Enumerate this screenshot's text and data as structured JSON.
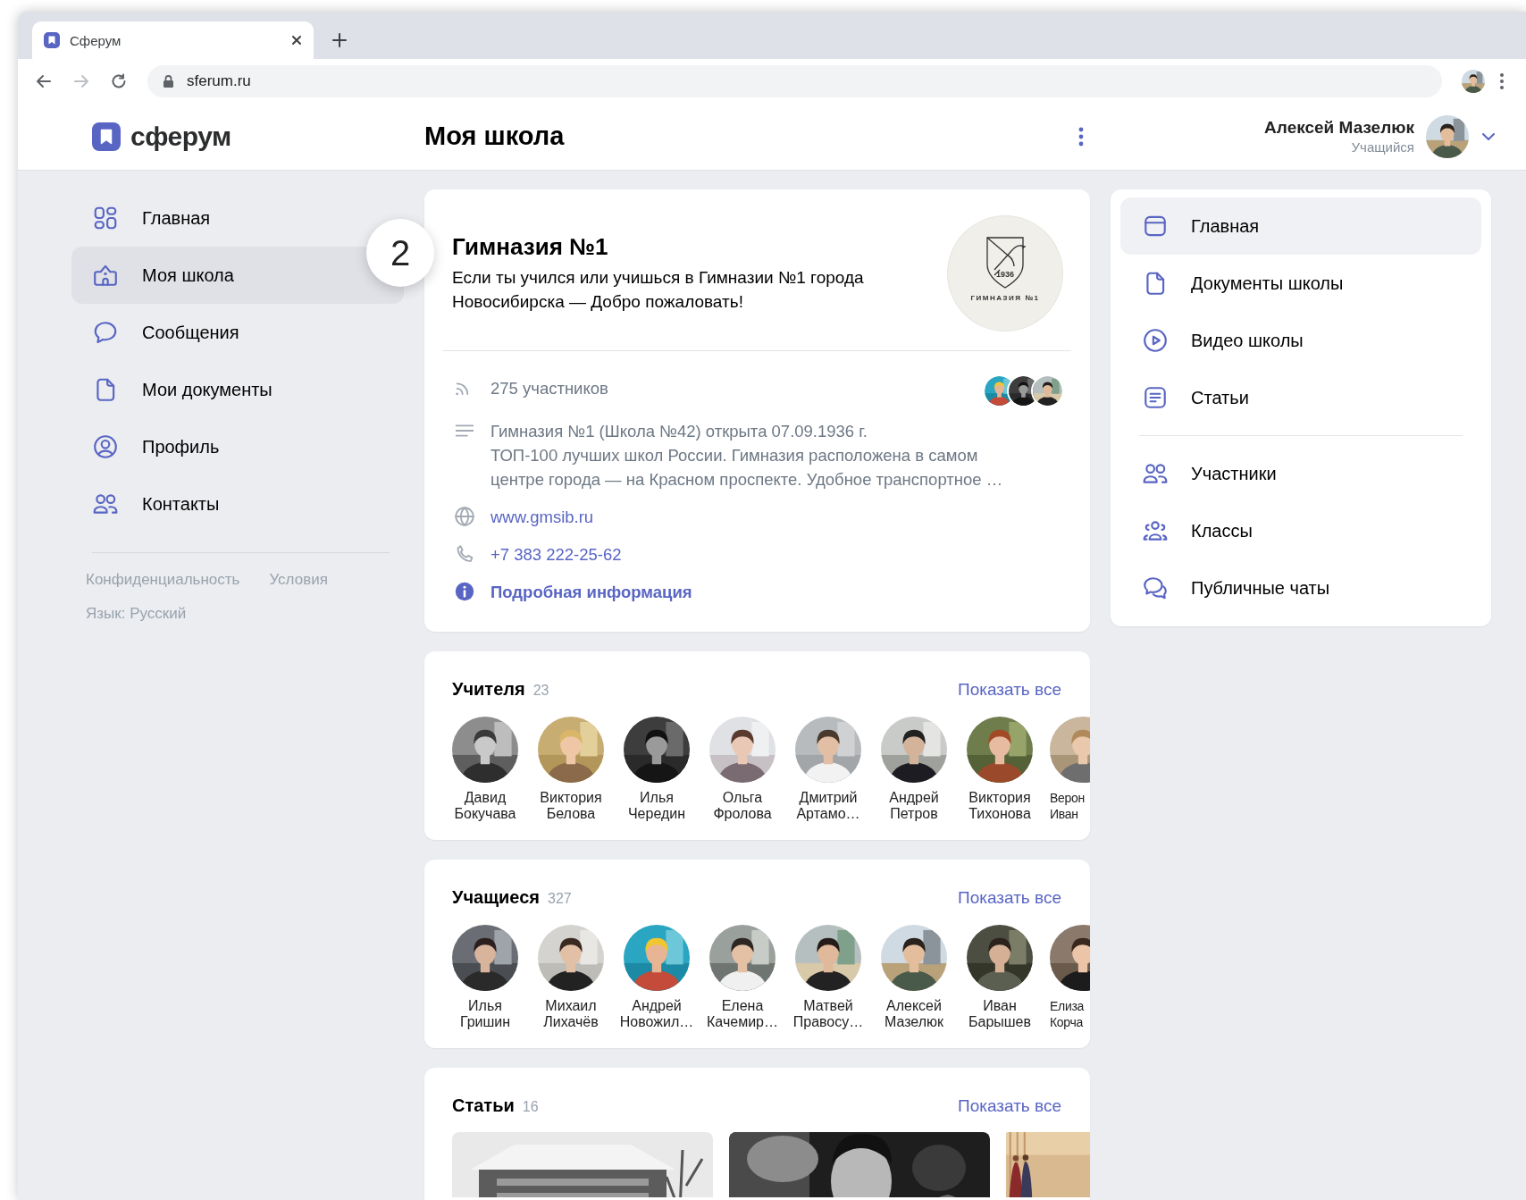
{
  "browser": {
    "tab": {
      "title": "Сферум",
      "selected": true
    },
    "address": "sferum.ru",
    "profile_avatar": {
      "kind": "picture"
    }
  },
  "header": {
    "logo_text": "сферум",
    "page_title": "Моя школа",
    "user": {
      "name": "Алексей Мазелюк",
      "role": "Учащийся",
      "avatar": {
        "kind": "picture"
      }
    }
  },
  "sidebar": {
    "items": [
      {
        "label": "Главная",
        "selected": false
      },
      {
        "label": "Моя школа",
        "selected": true
      },
      {
        "label": "Сообщения",
        "selected": false
      },
      {
        "label": "Мои документы",
        "selected": false
      },
      {
        "label": "Профиль",
        "selected": false
      },
      {
        "label": "Контакты",
        "selected": false
      }
    ],
    "links": [
      "Конфиденциальность",
      "Условия"
    ],
    "language": "Язык: Русский"
  },
  "step_badge": "2",
  "school": {
    "name": "Гимназия №1",
    "tagline": "Если ты учился или учишься в Гимназии №1 города Новосибирска — Добро пожаловать!",
    "logo": {
      "year": "1936",
      "caption": "ГИМНАЗИЯ №1"
    },
    "members": "275 участников",
    "member_avatars": [
      {
        "kind": "picture"
      },
      {
        "kind": "picture"
      },
      {
        "kind": "picture"
      }
    ],
    "description": [
      "Гимназия №1 (Школа №42) открыта 07.09.1936 г.",
      "ТОП-100 лучших школ России. Гимназия расположена в самом",
      "центре города — на Красном проспекте. Удобное транспортное …"
    ],
    "website": "www.gmsib.ru",
    "phone": "+7 383 222-25-62",
    "more_info": "Подробная информация"
  },
  "sections": [
    {
      "kind": "people",
      "title": "Учителя",
      "count": "23",
      "action": "Показать все",
      "people": [
        {
          "first_name": "Давид",
          "last_name": "Бокучава",
          "avatar": {
            "kind": "picture"
          }
        },
        {
          "first_name": "Виктория",
          "last_name": "Белова",
          "avatar": {
            "kind": "picture"
          }
        },
        {
          "first_name": "Илья",
          "last_name": "Чередин",
          "avatar": {
            "kind": "picture"
          }
        },
        {
          "first_name": "Ольга",
          "last_name": "Фролова",
          "avatar": {
            "kind": "picture"
          }
        },
        {
          "first_name": "Дмитрий",
          "last_name": "Артамо…",
          "avatar": {
            "kind": "picture"
          }
        },
        {
          "first_name": "Андрей",
          "last_name": "Петров",
          "avatar": {
            "kind": "picture"
          }
        },
        {
          "first_name": "Виктория",
          "last_name": "Тихонова",
          "avatar": {
            "kind": "picture"
          }
        },
        {
          "first_name": "Верон",
          "last_name": "Иван",
          "avatar": {
            "kind": "picture"
          }
        }
      ]
    },
    {
      "kind": "people",
      "title": "Учащиеся",
      "count": "327",
      "action": "Показать все",
      "people": [
        {
          "first_name": "Илья",
          "last_name": "Гришин",
          "avatar": {
            "kind": "picture"
          }
        },
        {
          "first_name": "Михаил",
          "last_name": "Лихачёв",
          "avatar": {
            "kind": "picture"
          }
        },
        {
          "first_name": "Андрей",
          "last_name": "Новожил…",
          "avatar": {
            "kind": "picture"
          }
        },
        {
          "first_name": "Елена",
          "last_name": "Качемир…",
          "avatar": {
            "kind": "picture"
          }
        },
        {
          "first_name": "Матвей",
          "last_name": "Правосу…",
          "avatar": {
            "kind": "picture"
          }
        },
        {
          "first_name": "Алексей",
          "last_name": "Мазелюк",
          "avatar": {
            "kind": "picture"
          }
        },
        {
          "first_name": "Иван",
          "last_name": "Барышев",
          "avatar": {
            "kind": "picture"
          }
        },
        {
          "first_name": "Елиза",
          "last_name": "Корча",
          "avatar": {
            "kind": "picture"
          }
        }
      ]
    },
    {
      "kind": "articles",
      "title": "Статьи",
      "count": "16",
      "action": "Показать все",
      "articles": [
        {
          "kind": "picture"
        },
        {
          "kind": "picture"
        },
        {
          "kind": "picture"
        }
      ]
    }
  ],
  "school_menu": {
    "groups": [
      {
        "items": [
          {
            "label": "Главная",
            "selected": true
          },
          {
            "label": "Документы школы",
            "selected": false
          },
          {
            "label": "Видео школы",
            "selected": false
          },
          {
            "label": "Статьи",
            "selected": false
          }
        ]
      },
      {
        "items": [
          {
            "label": "Участники",
            "selected": false
          },
          {
            "label": "Классы",
            "selected": false
          },
          {
            "label": "Публичные чаты",
            "selected": false
          }
        ]
      }
    ]
  }
}
